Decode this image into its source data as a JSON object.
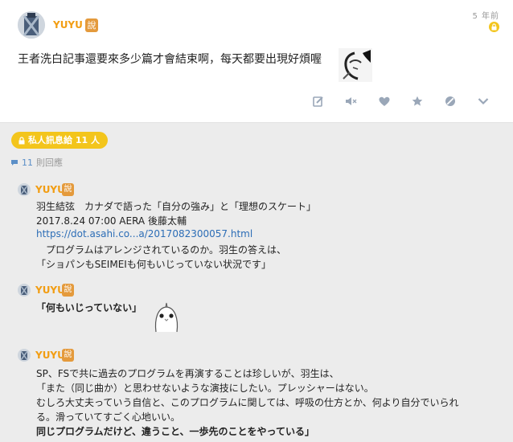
{
  "post": {
    "author": "YUYU",
    "say_badge": "說",
    "time": "5 年前",
    "text": "王者洗白記事還要來多少篇才會結束啊，每天都要出現好煩喔"
  },
  "actions": [
    "edit-icon",
    "mute-icon",
    "heart-icon",
    "star-icon",
    "block-icon",
    "chevron-down-icon"
  ],
  "private_badge": "私人訊息給 11 人",
  "reply_count": {
    "count": "11",
    "label": "則回應"
  },
  "replies": [
    {
      "author": "YUYU",
      "say_badge": "說",
      "lines": [
        "羽生結弦　カナダで語った「自分の強み」と「理想のスケート」",
        "2017.8.24 07:00 AERA 後藤太輔",
        "https://dot.asahi.co...a/2017082300057.html",
        "　プログラムはアレンジされているのか。羽生の答えは、",
        "「ショパンもSEIMEIも何もいじっていない状況です」"
      ]
    },
    {
      "author": "YUYU",
      "say_badge": "說",
      "lines": [
        "「何もいじっていない」"
      ]
    },
    {
      "author": "YUYU",
      "say_badge": "說",
      "lines": [
        "SP、FSで共に過去のプログラムを再演することは珍しいが、羽生は、",
        "「また（同じ曲か）と思わせないような演技にしたい。プレッシャーはない。",
        "むしろ大丈夫っていう自信と、このプログラムに関しては、呼吸の仕方とか、何より自分でいられ",
        "る。滑っていてすごく心地いい。",
        "同じプログラムだけど、違うこと、一歩先のことをやっている」"
      ]
    }
  ]
}
